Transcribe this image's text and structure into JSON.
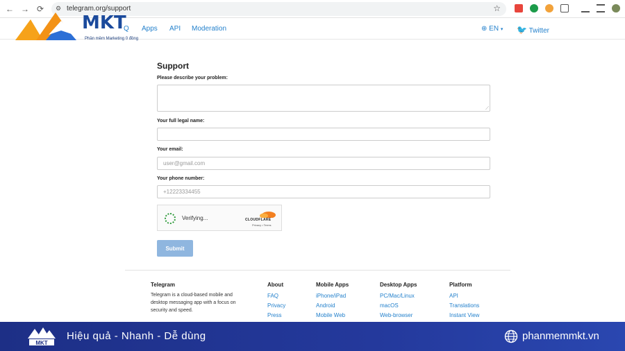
{
  "browser": {
    "url": "telegram.org/support",
    "back": "←",
    "forward": "→",
    "reload": "⟳"
  },
  "watermark": {
    "brand": "MKT",
    "tagline": "Phần mềm Marketing 0 đồng"
  },
  "header": {
    "nav": [
      "Apps",
      "API",
      "Moderation"
    ],
    "partial_nav": "Q",
    "language": "EN",
    "twitter": "Twitter"
  },
  "form": {
    "title": "Support",
    "problem_label": "Please describe your problem:",
    "name_label": "Your full legal name:",
    "email_label": "Your email:",
    "email_placeholder": "user@gmail.com",
    "phone_label": "Your phone number:",
    "phone_placeholder": "+12223334455",
    "captcha_status": "Verifying...",
    "captcha_brand": "CLOUDFLARE",
    "captcha_links": "Privacy • Terms",
    "submit": "Submit"
  },
  "footer": {
    "telegram": {
      "heading": "Telegram",
      "desc": "Telegram is a cloud-based mobile and desktop messaging app with a focus on security and speed."
    },
    "columns": [
      {
        "heading": "About",
        "links": [
          "FAQ",
          "Privacy",
          "Press"
        ]
      },
      {
        "heading": "Mobile Apps",
        "links": [
          "iPhone/iPad",
          "Android",
          "Mobile Web"
        ]
      },
      {
        "heading": "Desktop Apps",
        "links": [
          "PC/Mac/Linux",
          "macOS",
          "Web-browser"
        ]
      },
      {
        "heading": "Platform",
        "links": [
          "API",
          "Translations",
          "Instant View"
        ]
      }
    ]
  },
  "banner": {
    "slogan": "Hiệu quả - Nhanh - Dễ dùng",
    "site": "phanmemmkt.vn"
  },
  "colors": {
    "link": "#2481cc",
    "banner": "#24399c",
    "submit": "#8fb6df"
  }
}
